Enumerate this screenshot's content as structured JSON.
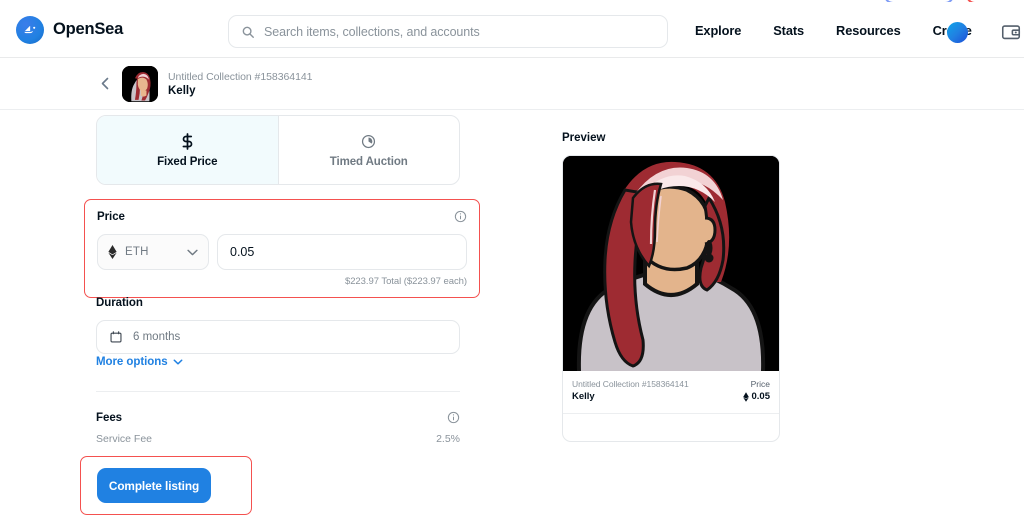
{
  "header": {
    "brand_name": "OpenSea",
    "brand_icon": "opensea-ship-logo",
    "search": {
      "icon": "search-icon",
      "placeholder": "Search items, collections, and accounts",
      "value": ""
    },
    "nav": [
      {
        "label": "Explore"
      },
      {
        "label": "Stats"
      },
      {
        "label": "Resources"
      },
      {
        "label": "Create"
      }
    ],
    "account_avatar_icon": "user-avatar-circle",
    "wallet_icon": "wallet-icon"
  },
  "item_bar": {
    "back_icon": "chevron-left-icon",
    "thumbnail_icon": "nft-thumbnail",
    "collection": "Untitled Collection #158364141",
    "name": "Kelly"
  },
  "listing": {
    "tabs": [
      {
        "label": "Fixed Price",
        "icon": "dollar-sign-icon",
        "active": true
      },
      {
        "label": "Timed Auction",
        "icon": "timer-clock-icon",
        "active": false
      }
    ],
    "price": {
      "label": "Price",
      "info_icon": "info-circle-icon",
      "currency": "ETH",
      "currency_icon": "ethereum-diamond-icon",
      "dropdown_icon": "chevron-down-icon",
      "value": "0.05",
      "total_text": "$223.97 Total ($223.97 each)",
      "highlight_color": "#f4514f"
    },
    "duration": {
      "label": "Duration",
      "calendar_icon": "calendar-icon",
      "value": "6 months"
    },
    "more_options": {
      "label": "More options",
      "icon": "chevron-down-icon"
    },
    "fees": {
      "label": "Fees",
      "info_icon": "info-circle-icon",
      "rows": [
        {
          "label": "Service Fee",
          "value": "2.5%"
        }
      ]
    },
    "cta": {
      "label": "Complete listing",
      "color": "#2081e2",
      "highlight_color": "#f4514f"
    }
  },
  "preview": {
    "title": "Preview",
    "artwork_icon": "faceless-woman-red-hair-illustration",
    "collection": "Untitled Collection #158364141",
    "name": "Kelly",
    "price_label": "Price",
    "price_icon": "ethereum-diamond-icon",
    "price_value": "0.05"
  }
}
